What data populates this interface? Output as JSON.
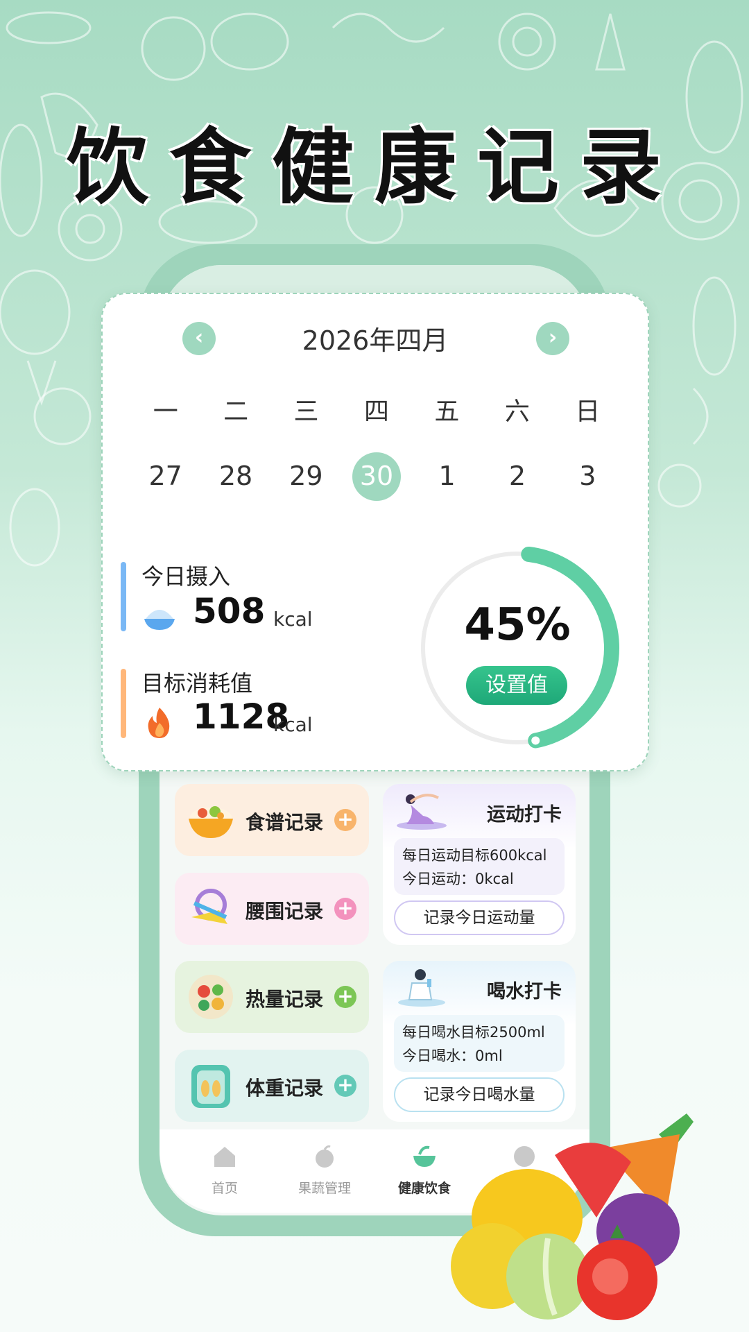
{
  "headline": "饮食健康记录",
  "calendar": {
    "month_title": "2026年四月",
    "prev_icon": "chevron-left-icon",
    "next_icon": "chevron-right-icon",
    "weekdays": [
      "一",
      "二",
      "三",
      "四",
      "五",
      "六",
      "日"
    ],
    "dates": [
      "27",
      "28",
      "29",
      "30",
      "1",
      "2",
      "3"
    ],
    "today_index": 3
  },
  "intake": {
    "label": "今日摄入",
    "value": "508",
    "unit": "kcal",
    "icon": "rice-bowl-icon"
  },
  "target": {
    "label": "目标消耗值",
    "value": "1128",
    "unit": "kcal",
    "icon": "flame-icon"
  },
  "progress": {
    "percent_text": "45%",
    "fraction": 0.45,
    "button": "设置值"
  },
  "colors": {
    "accent": "#1ea878",
    "ring": "#5fcfa4",
    "today": "#9fd8bf"
  },
  "tiles": [
    {
      "label": "食谱记录",
      "icon": "food-bowl-icon"
    },
    {
      "label": "腰围记录",
      "icon": "measuring-tape-icon"
    },
    {
      "label": "热量记录",
      "icon": "salad-plate-icon"
    },
    {
      "label": "体重记录",
      "icon": "scale-icon"
    }
  ],
  "exercise": {
    "title": "运动打卡",
    "goal": "每日运动目标600kcal",
    "today": "今日运动：0kcal",
    "button": "记录今日运动量"
  },
  "water": {
    "title": "喝水打卡",
    "goal": "每日喝水目标2500ml",
    "today": "今日喝水：0ml",
    "button": "记录今日喝水量"
  },
  "tabs": [
    {
      "label": "首页",
      "icon": "home-icon"
    },
    {
      "label": "果蔬管理",
      "icon": "apple-icon"
    },
    {
      "label": "健康饮食",
      "icon": "bowl-icon",
      "active": true
    },
    {
      "label": "",
      "icon": "profile-icon"
    }
  ]
}
